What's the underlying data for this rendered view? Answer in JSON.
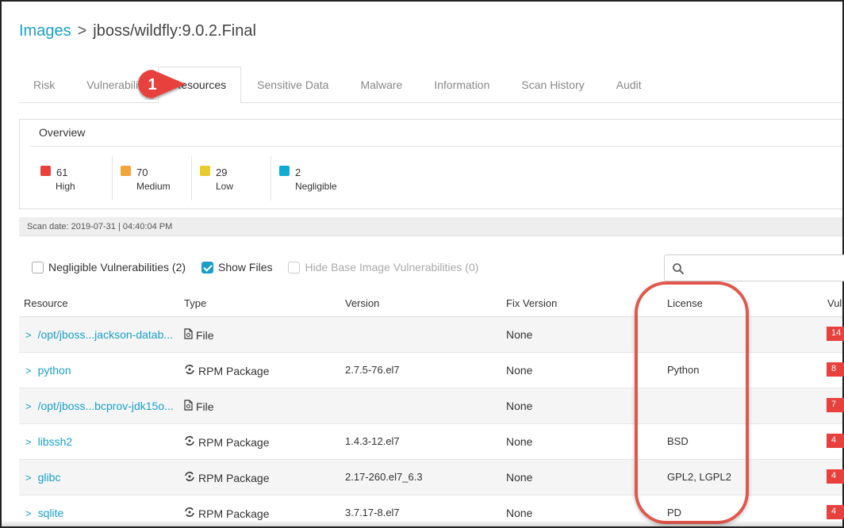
{
  "breadcrumb": {
    "parent": "Images",
    "separator": ">",
    "current": "jboss/wildfly:9.0.2.Final"
  },
  "tabs": [
    {
      "label": "Risk",
      "active": false
    },
    {
      "label": "Vulnerabili",
      "active": false
    },
    {
      "label": "Resources",
      "active": true
    },
    {
      "label": "Sensitive Data",
      "active": false
    },
    {
      "label": "Malware",
      "active": false
    },
    {
      "label": "Information",
      "active": false
    },
    {
      "label": "Scan History",
      "active": false
    },
    {
      "label": "Audit",
      "active": false
    }
  ],
  "callout": {
    "number": "1",
    "color": "#e8413d"
  },
  "overview": {
    "title": "Overview",
    "severities": [
      {
        "count": "61",
        "label": "High",
        "color": "#e8413d"
      },
      {
        "count": "70",
        "label": "Medium",
        "color": "#f0a53b"
      },
      {
        "count": "29",
        "label": "Low",
        "color": "#e5cc30"
      },
      {
        "count": "2",
        "label": "Negligible",
        "color": "#12aad1"
      }
    ]
  },
  "scan_date": "Scan date: 2019-07-31 | 04:40:04 PM",
  "filters": {
    "negligible": {
      "label": "Negligible Vulnerabilities (2)",
      "checked": false
    },
    "show_files": {
      "label": "Show Files",
      "checked": true
    },
    "hide_base": {
      "label": "Hide Base Image Vulnerabilities (0)",
      "checked": false,
      "disabled": true
    }
  },
  "search": {
    "placeholder": "",
    "icon": "search-icon"
  },
  "table": {
    "headers": {
      "resource": "Resource",
      "type": "Type",
      "version": "Version",
      "fix_version": "Fix Version",
      "license": "License",
      "vulns": "Vul"
    },
    "rows": [
      {
        "resource": "/opt/jboss...jackson-datab...",
        "type": "File",
        "type_icon": "file-icon",
        "version": "",
        "fix_version": "None",
        "license": "",
        "vulns": "14"
      },
      {
        "resource": "python",
        "type": "RPM Package",
        "type_icon": "package-icon",
        "version": "2.7.5-76.el7",
        "fix_version": "None",
        "license": "Python",
        "vulns": "8"
      },
      {
        "resource": "/opt/jboss...bcprov-jdk15o...",
        "type": "File",
        "type_icon": "file-icon",
        "version": "",
        "fix_version": "None",
        "license": "",
        "vulns": "7"
      },
      {
        "resource": "libssh2",
        "type": "RPM Package",
        "type_icon": "package-icon",
        "version": "1.4.3-12.el7",
        "fix_version": "None",
        "license": "BSD",
        "vulns": "4"
      },
      {
        "resource": "glibc",
        "type": "RPM Package",
        "type_icon": "package-icon",
        "version": "2.17-260.el7_6.3",
        "fix_version": "None",
        "license": "GPL2, LGPL2",
        "vulns": "4"
      },
      {
        "resource": "sqlite",
        "type": "RPM Package",
        "type_icon": "package-icon",
        "version": "3.7.17-8.el7",
        "fix_version": "None",
        "license": "PD",
        "vulns": "4"
      }
    ]
  },
  "colors": {
    "accent": "#1a9fc7",
    "highlight": "#e2574c",
    "badge_high": "#e8413d"
  }
}
